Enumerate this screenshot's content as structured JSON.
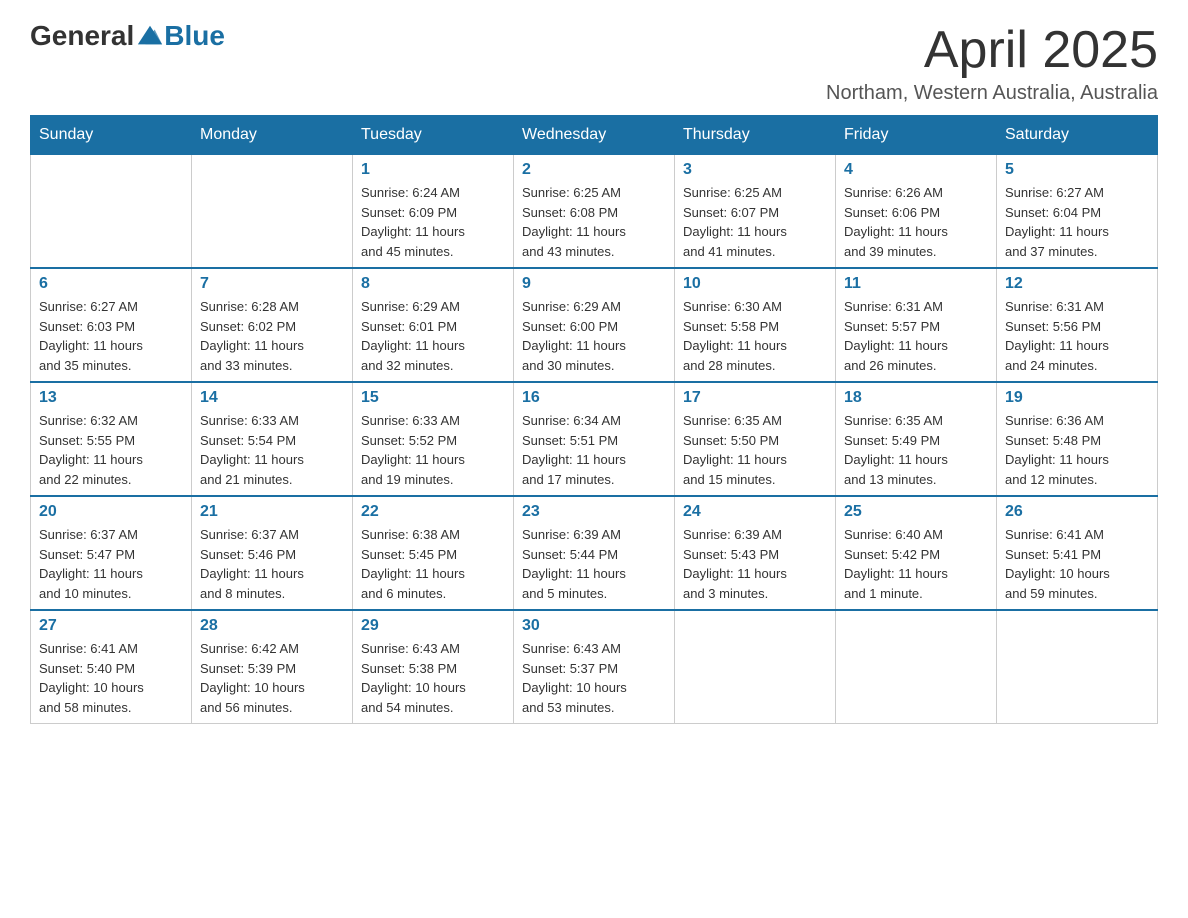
{
  "header": {
    "logo_general": "General",
    "logo_blue": "Blue",
    "month_year": "April 2025",
    "location": "Northam, Western Australia, Australia"
  },
  "weekdays": [
    "Sunday",
    "Monday",
    "Tuesday",
    "Wednesday",
    "Thursday",
    "Friday",
    "Saturday"
  ],
  "weeks": [
    [
      {
        "day": "",
        "info": ""
      },
      {
        "day": "",
        "info": ""
      },
      {
        "day": "1",
        "info": "Sunrise: 6:24 AM\nSunset: 6:09 PM\nDaylight: 11 hours\nand 45 minutes."
      },
      {
        "day": "2",
        "info": "Sunrise: 6:25 AM\nSunset: 6:08 PM\nDaylight: 11 hours\nand 43 minutes."
      },
      {
        "day": "3",
        "info": "Sunrise: 6:25 AM\nSunset: 6:07 PM\nDaylight: 11 hours\nand 41 minutes."
      },
      {
        "day": "4",
        "info": "Sunrise: 6:26 AM\nSunset: 6:06 PM\nDaylight: 11 hours\nand 39 minutes."
      },
      {
        "day": "5",
        "info": "Sunrise: 6:27 AM\nSunset: 6:04 PM\nDaylight: 11 hours\nand 37 minutes."
      }
    ],
    [
      {
        "day": "6",
        "info": "Sunrise: 6:27 AM\nSunset: 6:03 PM\nDaylight: 11 hours\nand 35 minutes."
      },
      {
        "day": "7",
        "info": "Sunrise: 6:28 AM\nSunset: 6:02 PM\nDaylight: 11 hours\nand 33 minutes."
      },
      {
        "day": "8",
        "info": "Sunrise: 6:29 AM\nSunset: 6:01 PM\nDaylight: 11 hours\nand 32 minutes."
      },
      {
        "day": "9",
        "info": "Sunrise: 6:29 AM\nSunset: 6:00 PM\nDaylight: 11 hours\nand 30 minutes."
      },
      {
        "day": "10",
        "info": "Sunrise: 6:30 AM\nSunset: 5:58 PM\nDaylight: 11 hours\nand 28 minutes."
      },
      {
        "day": "11",
        "info": "Sunrise: 6:31 AM\nSunset: 5:57 PM\nDaylight: 11 hours\nand 26 minutes."
      },
      {
        "day": "12",
        "info": "Sunrise: 6:31 AM\nSunset: 5:56 PM\nDaylight: 11 hours\nand 24 minutes."
      }
    ],
    [
      {
        "day": "13",
        "info": "Sunrise: 6:32 AM\nSunset: 5:55 PM\nDaylight: 11 hours\nand 22 minutes."
      },
      {
        "day": "14",
        "info": "Sunrise: 6:33 AM\nSunset: 5:54 PM\nDaylight: 11 hours\nand 21 minutes."
      },
      {
        "day": "15",
        "info": "Sunrise: 6:33 AM\nSunset: 5:52 PM\nDaylight: 11 hours\nand 19 minutes."
      },
      {
        "day": "16",
        "info": "Sunrise: 6:34 AM\nSunset: 5:51 PM\nDaylight: 11 hours\nand 17 minutes."
      },
      {
        "day": "17",
        "info": "Sunrise: 6:35 AM\nSunset: 5:50 PM\nDaylight: 11 hours\nand 15 minutes."
      },
      {
        "day": "18",
        "info": "Sunrise: 6:35 AM\nSunset: 5:49 PM\nDaylight: 11 hours\nand 13 minutes."
      },
      {
        "day": "19",
        "info": "Sunrise: 6:36 AM\nSunset: 5:48 PM\nDaylight: 11 hours\nand 12 minutes."
      }
    ],
    [
      {
        "day": "20",
        "info": "Sunrise: 6:37 AM\nSunset: 5:47 PM\nDaylight: 11 hours\nand 10 minutes."
      },
      {
        "day": "21",
        "info": "Sunrise: 6:37 AM\nSunset: 5:46 PM\nDaylight: 11 hours\nand 8 minutes."
      },
      {
        "day": "22",
        "info": "Sunrise: 6:38 AM\nSunset: 5:45 PM\nDaylight: 11 hours\nand 6 minutes."
      },
      {
        "day": "23",
        "info": "Sunrise: 6:39 AM\nSunset: 5:44 PM\nDaylight: 11 hours\nand 5 minutes."
      },
      {
        "day": "24",
        "info": "Sunrise: 6:39 AM\nSunset: 5:43 PM\nDaylight: 11 hours\nand 3 minutes."
      },
      {
        "day": "25",
        "info": "Sunrise: 6:40 AM\nSunset: 5:42 PM\nDaylight: 11 hours\nand 1 minute."
      },
      {
        "day": "26",
        "info": "Sunrise: 6:41 AM\nSunset: 5:41 PM\nDaylight: 10 hours\nand 59 minutes."
      }
    ],
    [
      {
        "day": "27",
        "info": "Sunrise: 6:41 AM\nSunset: 5:40 PM\nDaylight: 10 hours\nand 58 minutes."
      },
      {
        "day": "28",
        "info": "Sunrise: 6:42 AM\nSunset: 5:39 PM\nDaylight: 10 hours\nand 56 minutes."
      },
      {
        "day": "29",
        "info": "Sunrise: 6:43 AM\nSunset: 5:38 PM\nDaylight: 10 hours\nand 54 minutes."
      },
      {
        "day": "30",
        "info": "Sunrise: 6:43 AM\nSunset: 5:37 PM\nDaylight: 10 hours\nand 53 minutes."
      },
      {
        "day": "",
        "info": ""
      },
      {
        "day": "",
        "info": ""
      },
      {
        "day": "",
        "info": ""
      }
    ]
  ]
}
